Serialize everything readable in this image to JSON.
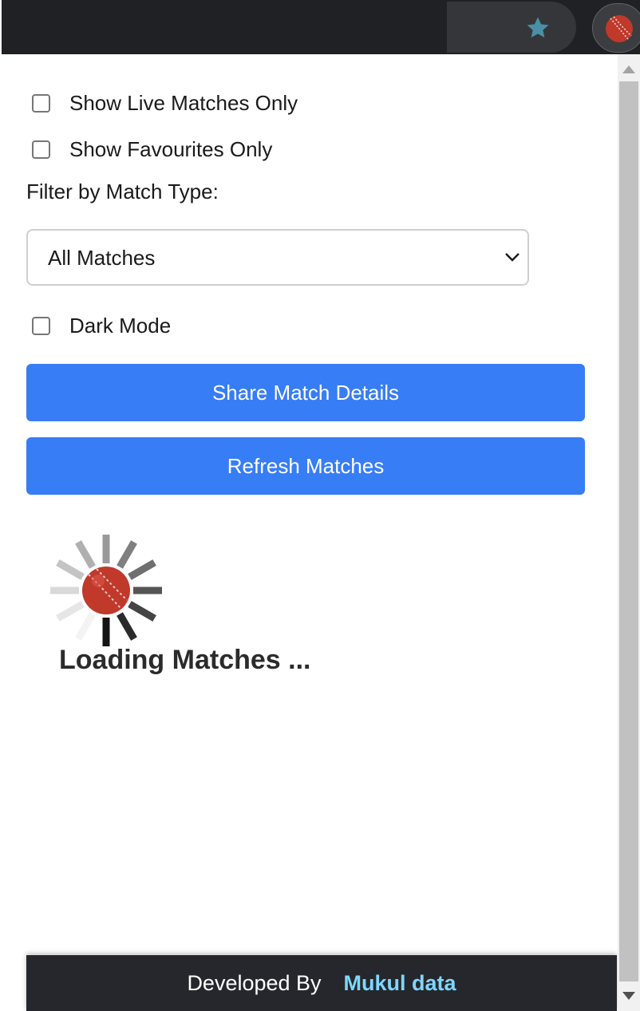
{
  "browser": {
    "bookmark_icon": "star-icon",
    "extension_icon": "cricket-ball-icon",
    "star_color": "#4a8fa6"
  },
  "filters": {
    "live_only_label": "Show Live Matches Only",
    "favourites_only_label": "Show Favourites Only",
    "match_type_label": "Filter by Match Type:",
    "match_type_selected": "All Matches",
    "dark_mode_label": "Dark Mode"
  },
  "actions": {
    "share_label": "Share Match Details",
    "refresh_label": "Refresh Matches"
  },
  "status": {
    "loading_text": "Loading Matches ..."
  },
  "footer": {
    "developed_by": "Developed By",
    "developer_name": "Mukul data"
  },
  "colors": {
    "button": "#377df5",
    "footer_bg": "#25272c",
    "developer_link": "#7fd6ff",
    "ball": "#c0392b"
  }
}
